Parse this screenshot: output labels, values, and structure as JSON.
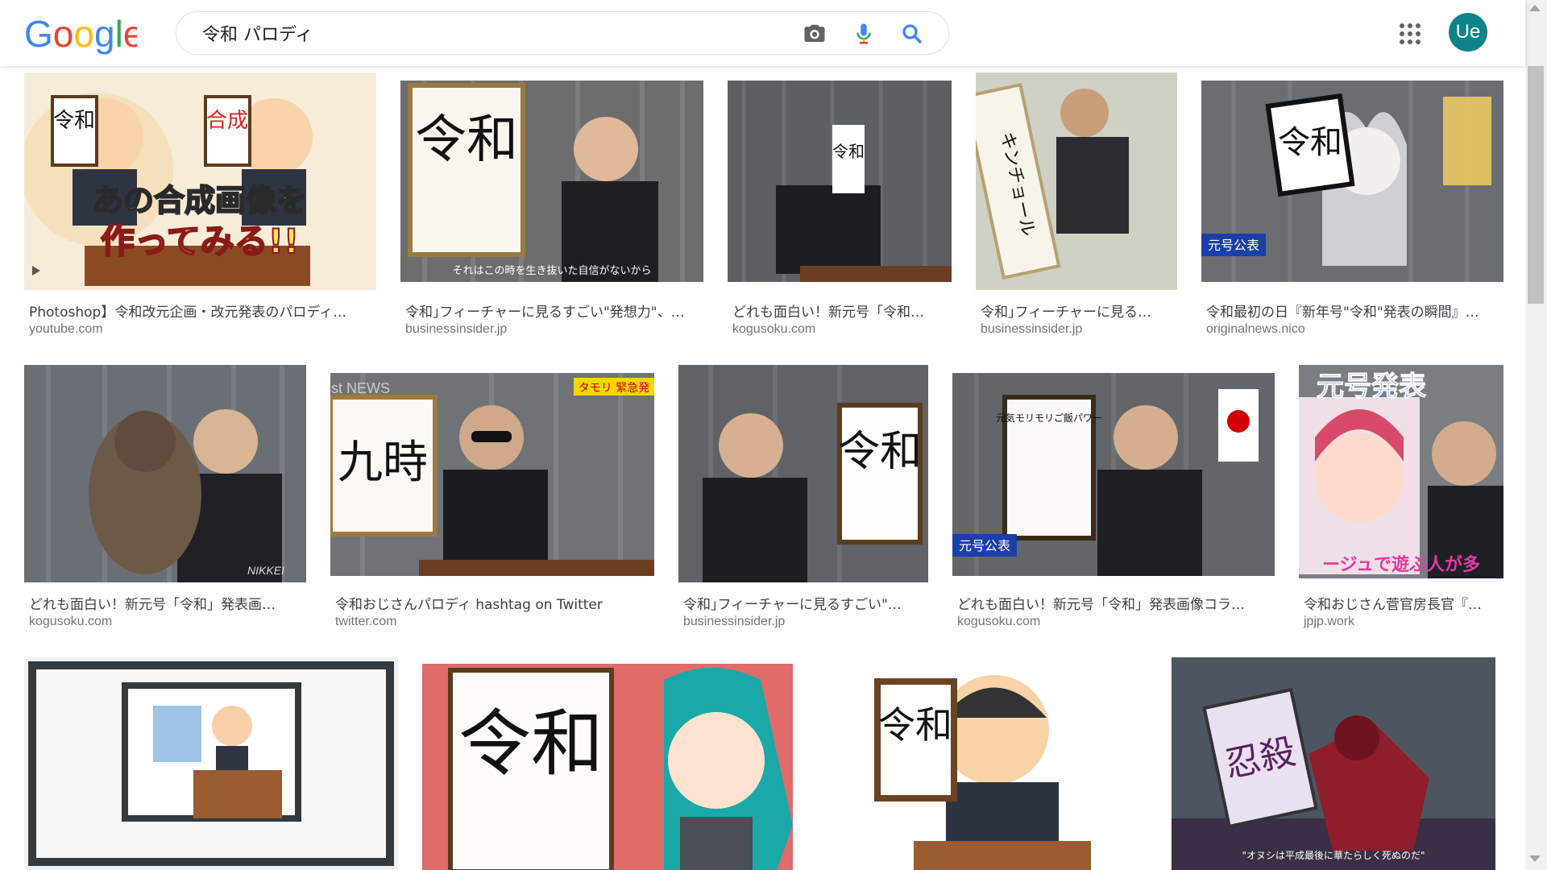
{
  "search": {
    "query": "令和 パロディ"
  },
  "header": {
    "avatar_initials": "Ue",
    "accent": "#0b8389"
  },
  "results": [
    {
      "caption": "Photoshop】令和改元企画・改元発表のパロディ…",
      "source": "youtube.com"
    },
    {
      "caption": "令和｣フィーチャーに見るすごい\"発想力\"、…",
      "source": "businessinsider.jp"
    },
    {
      "caption": "どれも面白い！新元号「令和…",
      "source": "kogusoku.com"
    },
    {
      "caption": "令和｣フィーチャーに見る…",
      "source": "businessinsider.jp"
    },
    {
      "caption": "令和最初の日『新年号\"令和\"発表の瞬間』…",
      "source": "originalnews.nico"
    },
    {
      "caption": "どれも面白い！新元号「令和」発表画…",
      "source": "kogusoku.com"
    },
    {
      "caption": "令和おじさんパロディ hashtag on Twitter",
      "source": "twitter.com"
    },
    {
      "caption": "令和｣フィーチャーに見るすごい\"…",
      "source": "businessinsider.jp"
    },
    {
      "caption": "どれも面白い！新元号「令和」発表画像コラ…",
      "source": "kogusoku.com"
    },
    {
      "caption": "令和おじさん菅官房長官『…",
      "source": "jpjp.work"
    }
  ],
  "image_text": {
    "thumb1_line1": "あの合成画像を",
    "thumb1_line2": "作ってみる!!",
    "thumb1_board1": "令和",
    "thumb1_board2": "合成",
    "thumb2_board": "令和",
    "thumb2_sub": "それはこの時を生き抜いた自信がないから",
    "thumb3_board": "令和",
    "thumb4_board": "キンチョール",
    "thumb5_board": "令和",
    "thumb5_tag": "元号公表",
    "thumb6_tag": "NIKKEI",
    "thumb7_board": "九時",
    "thumb7_tag": "タモリ 緊急発",
    "thumb7_logo": "Mst NEWS",
    "thumb8_board": "令和",
    "thumb9_board": "元気モリモリご飯パワー",
    "thumb9_tag": "元号公表",
    "thumb10_title": "元号発表",
    "thumb10_sub": "ージュで遊ぶ人が多",
    "thumb12_board": "令和",
    "thumb13_board": "令和",
    "thumb14_board": "忍殺",
    "thumb14_sub": "\"オヌシは平成最後に華たらしく死ぬのだ\""
  }
}
